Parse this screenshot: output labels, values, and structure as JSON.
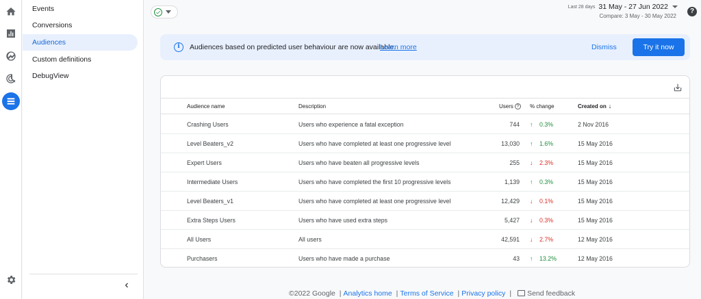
{
  "nav": {
    "items": [
      {
        "label": "Events",
        "active": false
      },
      {
        "label": "Conversions",
        "active": false
      },
      {
        "label": "Audiences",
        "active": true
      },
      {
        "label": "Custom definitions",
        "active": false
      },
      {
        "label": "DebugView",
        "active": false
      }
    ],
    "collapse_glyph": "‹"
  },
  "header": {
    "date_label": "Last 28 days",
    "date_range": "31 May - 27 Jun 2022",
    "compare": "Compare: 3 May - 30 May 2022",
    "help_glyph": "?"
  },
  "banner": {
    "info_glyph": "i",
    "message": "Audiences based on predicted user behaviour are now available.",
    "learn_more": "Learn more",
    "dismiss": "Dismiss",
    "try_it": "Try it now"
  },
  "table": {
    "columns": {
      "name": "Audience name",
      "description": "Description",
      "users": "Users",
      "change": "% change",
      "created": "Created on"
    },
    "rows": [
      {
        "name": "Crashing Users",
        "description": "Users who experience a fatal exception",
        "users": "744",
        "change": "0.3%",
        "direction": "up",
        "created": "2 Nov 2016"
      },
      {
        "name": "Level Beaters_v2",
        "description": "Users who have completed at least one progressive level",
        "users": "13,030",
        "change": "1.6%",
        "direction": "up",
        "created": "15 May 2016"
      },
      {
        "name": "Expert Users",
        "description": "Users who have beaten all progressive levels",
        "users": "255",
        "change": "2.3%",
        "direction": "down",
        "created": "15 May 2016"
      },
      {
        "name": "Intermediate Users",
        "description": "Users who have completed the first 10 progressive levels",
        "users": "1,139",
        "change": "0.3%",
        "direction": "up",
        "created": "15 May 2016"
      },
      {
        "name": "Level Beaters_v1",
        "description": "Users who have completed at least one progressive level",
        "users": "12,429",
        "change": "0.1%",
        "direction": "down",
        "created": "15 May 2016"
      },
      {
        "name": "Extra Steps Users",
        "description": "Users who have used extra steps",
        "users": "5,427",
        "change": "0.3%",
        "direction": "down",
        "created": "15 May 2016"
      },
      {
        "name": "All Users",
        "description": "All users",
        "users": "42,591",
        "change": "2.7%",
        "direction": "down",
        "created": "12 May 2016"
      },
      {
        "name": "Purchasers",
        "description": "Users who have made a purchase",
        "users": "43",
        "change": "13.2%",
        "direction": "up",
        "created": "12 May 2016"
      }
    ]
  },
  "footer": {
    "copyright": "©2022 Google",
    "analytics_home": "Analytics home",
    "terms": "Terms of Service",
    "privacy": "Privacy policy",
    "feedback": "Send feedback",
    "separator": "|"
  },
  "colors": {
    "accent": "#1a73e8",
    "positive": "#1e8e3e",
    "negative": "#d93025"
  }
}
